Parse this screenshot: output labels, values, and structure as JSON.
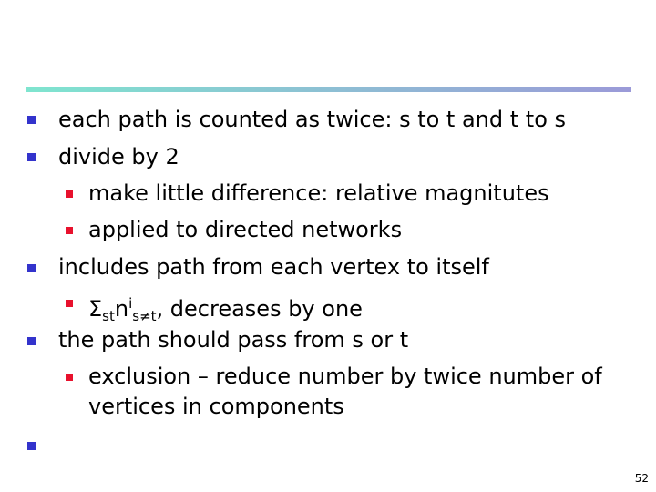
{
  "slide": {
    "bullets": [
      {
        "level": 1,
        "text": "each path is counted as twice: s to t and t to s"
      },
      {
        "level": 1,
        "text": "divide by 2"
      },
      {
        "level": 2,
        "text": "make little  difference: relative magnitutes"
      },
      {
        "level": 2,
        "text": "applied to directed networks"
      },
      {
        "level": 1,
        "text": "includes path from each vertex to itself"
      },
      {
        "level": 2,
        "formula": {
          "sigma": "Σ",
          "sigma_sub": "st",
          "n": "n",
          "n_sup": "i",
          "n_sub": "s≠t",
          "rest": ", decreases by one"
        }
      },
      {
        "level": 1,
        "text": "the path should pass from s or t"
      },
      {
        "level": 2,
        "text": "exclusion – reduce number by twice number of"
      },
      {
        "level": 2,
        "text": "vertices in  components",
        "continuation": true
      },
      {
        "level": 1,
        "text": ""
      }
    ],
    "page_number": "52",
    "colors": {
      "bullet_level1": "#3333cc",
      "bullet_level2": "#e8112d"
    }
  }
}
